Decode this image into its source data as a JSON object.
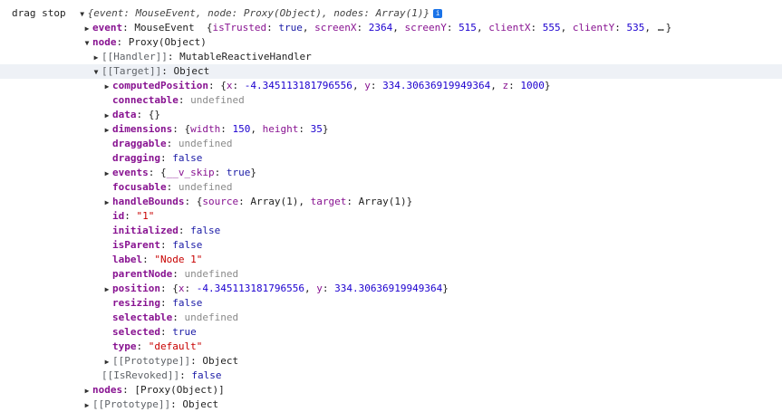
{
  "log": {
    "label": "drag stop",
    "summary": {
      "open": "{",
      "k1": "event",
      "v1": "MouseEvent",
      "k2": "node",
      "v2": "Proxy(Object)",
      "k3": "nodes",
      "v3": "Array(1)",
      "close": "}",
      "info": "i"
    }
  },
  "event": {
    "key": "event",
    "type": "MouseEvent",
    "preview": {
      "isTrusted_key": "isTrusted",
      "isTrusted": "true",
      "screenX_key": "screenX",
      "screenX": "2364",
      "screenY_key": "screenY",
      "screenY": "515",
      "clientX_key": "clientX",
      "clientX": "555",
      "clientY_key": "clientY",
      "clientY": "535",
      "more": "…"
    }
  },
  "node": {
    "key": "node",
    "type": "Proxy(Object)",
    "handler_key": "[[Handler]]",
    "handler": "MutableReactiveHandler",
    "target_key": "[[Target]]",
    "target_type": "Object",
    "isRevoked_key": "[[IsRevoked]]",
    "isRevoked": "false"
  },
  "target": {
    "computedPosition": {
      "key": "computedPosition",
      "x_key": "x",
      "x": "-4.345113181796556",
      "y_key": "y",
      "y": "334.30636919949364",
      "z_key": "z",
      "z": "1000"
    },
    "connectable": {
      "key": "connectable",
      "value": "undefined"
    },
    "data": {
      "key": "data",
      "value": "{}"
    },
    "dimensions": {
      "key": "dimensions",
      "width_key": "width",
      "width": "150",
      "height_key": "height",
      "height": "35"
    },
    "draggable": {
      "key": "draggable",
      "value": "undefined"
    },
    "dragging": {
      "key": "dragging",
      "value": "false"
    },
    "events": {
      "key": "events",
      "skip_key": "__v_skip",
      "skip": "true"
    },
    "focusable": {
      "key": "focusable",
      "value": "undefined"
    },
    "handleBounds": {
      "key": "handleBounds",
      "source_key": "source",
      "source": "Array(1)",
      "target_key": "target",
      "target": "Array(1)"
    },
    "id": {
      "key": "id",
      "value": "\"1\""
    },
    "initialized": {
      "key": "initialized",
      "value": "false"
    },
    "isParent": {
      "key": "isParent",
      "value": "false"
    },
    "label": {
      "key": "label",
      "value": "\"Node 1\""
    },
    "parentNode": {
      "key": "parentNode",
      "value": "undefined"
    },
    "position": {
      "key": "position",
      "x_key": "x",
      "x": "-4.345113181796556",
      "y_key": "y",
      "y": "334.30636919949364"
    },
    "resizing": {
      "key": "resizing",
      "value": "false"
    },
    "selectable": {
      "key": "selectable",
      "value": "undefined"
    },
    "selected": {
      "key": "selected",
      "value": "true"
    },
    "type": {
      "key": "type",
      "value": "\"default\""
    },
    "prototype_key": "[[Prototype]]",
    "prototype": "Object"
  },
  "nodes": {
    "key": "nodes",
    "value": "[Proxy(Object)]"
  },
  "root_prototype": {
    "key": "[[Prototype]]",
    "value": "Object"
  },
  "icons": {
    "collapsed": "▶",
    "expanded": "▼"
  }
}
